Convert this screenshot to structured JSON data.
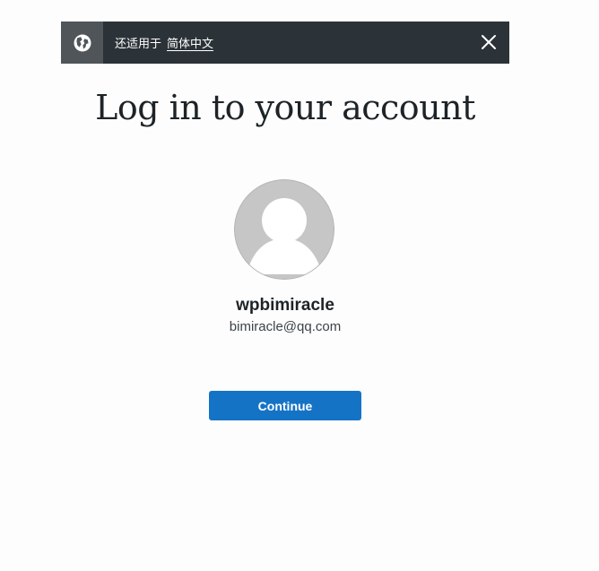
{
  "language_banner": {
    "prefix_text": "还适用于",
    "language_link": "简体中文",
    "icon": "globe-icon",
    "close_icon": "close-icon"
  },
  "title": "Log in to your account",
  "account": {
    "avatar_icon": "default-avatar-icon",
    "username": "wpbimiracle",
    "email": "bimiracle@qq.com"
  },
  "actions": {
    "continue_label": "Continue"
  },
  "colors": {
    "banner_bg": "#2c3338",
    "globe_box_bg": "#4f5559",
    "primary_button": "#1573c6",
    "avatar_bg": "#c6c6c6"
  }
}
